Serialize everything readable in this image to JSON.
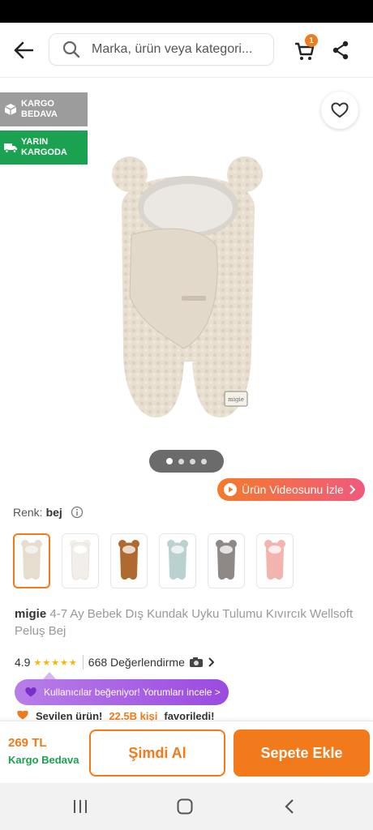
{
  "header": {
    "search_placeholder": "Marka, ürün veya kategori...",
    "cart_count": "1"
  },
  "badges": {
    "kargo": "KARGO BEDAVA",
    "yarin": "YARIN KARGODA"
  },
  "gallery": {
    "image_count": 4,
    "active_index": 0,
    "video_button": "Ürün Videosunu İzle"
  },
  "product": {
    "color_label": "Renk:",
    "color_value": "bej",
    "variants": [
      {
        "name": "bej",
        "color": "#e6ddcf",
        "selected": true
      },
      {
        "name": "beyaz",
        "color": "#f2efea"
      },
      {
        "name": "kahve",
        "color": "#b06a30"
      },
      {
        "name": "mint",
        "color": "#b9d1cf"
      },
      {
        "name": "gri",
        "color": "#8e8886"
      },
      {
        "name": "pembe",
        "color": "#f3b3ae"
      }
    ],
    "brand": "migie",
    "title": "4-7 Ay Bebek Dış Kundak Uyku Tulumu Kıvırcık Wellsoft Peluş Bej",
    "rating": "4.9",
    "stars": "★★★★★",
    "review_count": "668 Değerlendirme",
    "social_proof": "Kullanıcılar beğeniyor! Yorumları incele >",
    "fav_prefix": "Sevilen ürün!",
    "fav_count": "22.5B kişi",
    "fav_suffix": "favoriledi!"
  },
  "bottom": {
    "price": "269 TL",
    "shipping": "Kargo Bedava",
    "buy_now": "Şimdi Al",
    "add_to_cart": "Sepete Ekle"
  },
  "colors": {
    "accent": "#f27a1a",
    "green": "#1aa251",
    "badge_grey": "#9c9c9c",
    "purple": "#9b4ae0"
  }
}
